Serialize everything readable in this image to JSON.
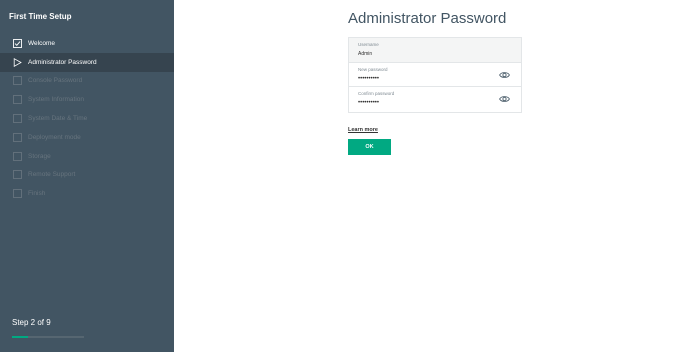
{
  "sidebar": {
    "title": "First Time Setup",
    "items": [
      {
        "label": "Welcome",
        "icon": "checkbox-checked-icon",
        "state": "done"
      },
      {
        "label": "Administrator Password",
        "icon": "play-outline-icon",
        "state": "active"
      },
      {
        "label": "Console Password",
        "icon": "checkbox-icon",
        "state": "disabled"
      },
      {
        "label": "System Information",
        "icon": "checkbox-icon",
        "state": "disabled"
      },
      {
        "label": "System Date & Time",
        "icon": "checkbox-icon",
        "state": "disabled"
      },
      {
        "label": "Deployment mode",
        "icon": "checkbox-icon",
        "state": "disabled"
      },
      {
        "label": "Storage",
        "icon": "checkbox-icon",
        "state": "disabled"
      },
      {
        "label": "Remote Support",
        "icon": "checkbox-icon",
        "state": "disabled"
      },
      {
        "label": "Finish",
        "icon": "checkbox-icon",
        "state": "disabled"
      }
    ],
    "step_text": "Step 2 of 9",
    "progress": 0.22
  },
  "main": {
    "title": "Administrator Password",
    "username": {
      "label": "Username",
      "value": "Admin"
    },
    "new_password": {
      "label": "New password",
      "value": "••••••••••"
    },
    "confirm_password": {
      "label": "Confirm password",
      "value": "••••••••••"
    },
    "learn_more": "Learn more",
    "ok_label": "OK"
  },
  "colors": {
    "sidebar_bg": "#425563",
    "sidebar_active": "#36444f",
    "accent": "#01a982"
  }
}
